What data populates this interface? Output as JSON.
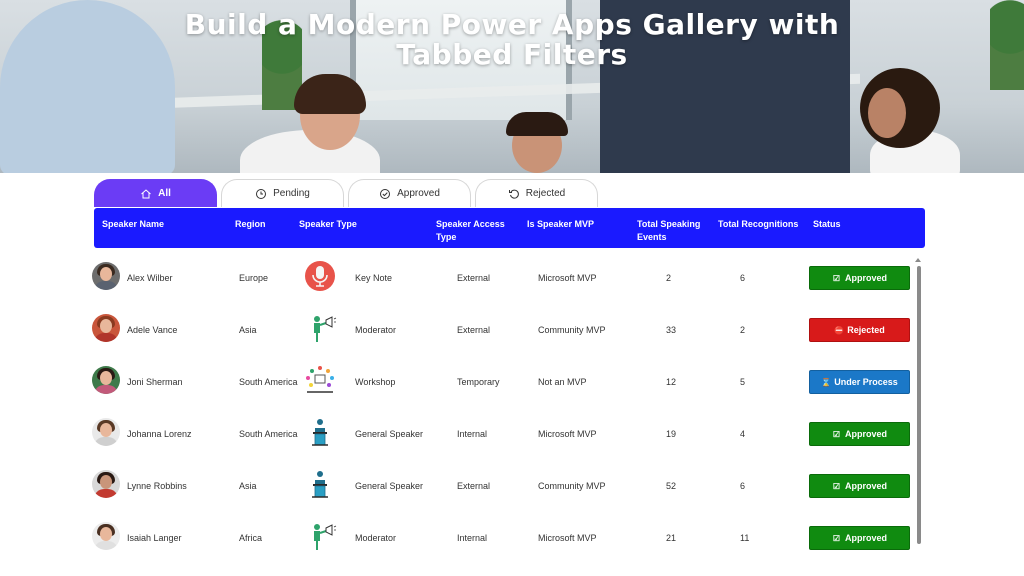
{
  "hero": {
    "title_line1": "Build a Modern Power Apps Gallery with",
    "title_line2": "Tabbed Filters"
  },
  "tabs": [
    {
      "label": "All",
      "icon": "home-icon",
      "active": true
    },
    {
      "label": "Pending",
      "icon": "clock-icon",
      "active": false
    },
    {
      "label": "Approved",
      "icon": "check-circle-icon",
      "active": false
    },
    {
      "label": "Rejected",
      "icon": "undo-icon",
      "active": false
    }
  ],
  "columns": {
    "speaker_name": "Speaker Name",
    "region": "Region",
    "speaker_type": "Speaker Type",
    "access_type_1": "Speaker Access",
    "access_type_2": "Type",
    "is_mvp": "Is Speaker MVP",
    "events_1": "Total Speaking",
    "events_2": "Events",
    "recognitions": "Total Recognitions",
    "status": "Status"
  },
  "rows": [
    {
      "name": "Alex Wilber",
      "region": "Europe",
      "type": "Key Note",
      "type_icon": "microphone-icon",
      "access": "External",
      "mvp": "Microsoft MVP",
      "events": "2",
      "recognitions": "6",
      "status": "Approved",
      "status_icon": "checkbox-icon"
    },
    {
      "name": "Adele Vance",
      "region": "Asia",
      "type": "Moderator",
      "type_icon": "moderator-megaphone-icon",
      "access": "External",
      "mvp": "Community MVP",
      "events": "33",
      "recognitions": "2",
      "status": "Rejected",
      "status_icon": "no-entry-icon"
    },
    {
      "name": "Joni Sherman",
      "region": "South America",
      "type": "Workshop",
      "type_icon": "workshop-icon",
      "access": "Temporary",
      "mvp": "Not an MVP",
      "events": "12",
      "recognitions": "5",
      "status": "Under Process",
      "status_icon": "hourglass-icon"
    },
    {
      "name": "Johanna Lorenz",
      "region": "South America",
      "type": "General Speaker",
      "type_icon": "podium-icon",
      "access": "Internal",
      "mvp": "Microsoft MVP",
      "events": "19",
      "recognitions": "4",
      "status": "Approved",
      "status_icon": "checkbox-icon"
    },
    {
      "name": "Lynne Robbins",
      "region": "Asia",
      "type": "General Speaker",
      "type_icon": "podium-icon",
      "access": "External",
      "mvp": "Community MVP",
      "events": "52",
      "recognitions": "6",
      "status": "Approved",
      "status_icon": "checkbox-icon"
    },
    {
      "name": "Isaiah Langer",
      "region": "Africa",
      "type": "Moderator",
      "type_icon": "moderator-megaphone-icon",
      "access": "Internal",
      "mvp": "Microsoft MVP",
      "events": "21",
      "recognitions": "11",
      "status": "Approved",
      "status_icon": "checkbox-icon"
    }
  ],
  "colors": {
    "active_tab": "#6b3cf5",
    "header": "#1a1aff",
    "approved": "#108b10",
    "rejected": "#d81a1a",
    "under_process": "#1b78c8"
  }
}
